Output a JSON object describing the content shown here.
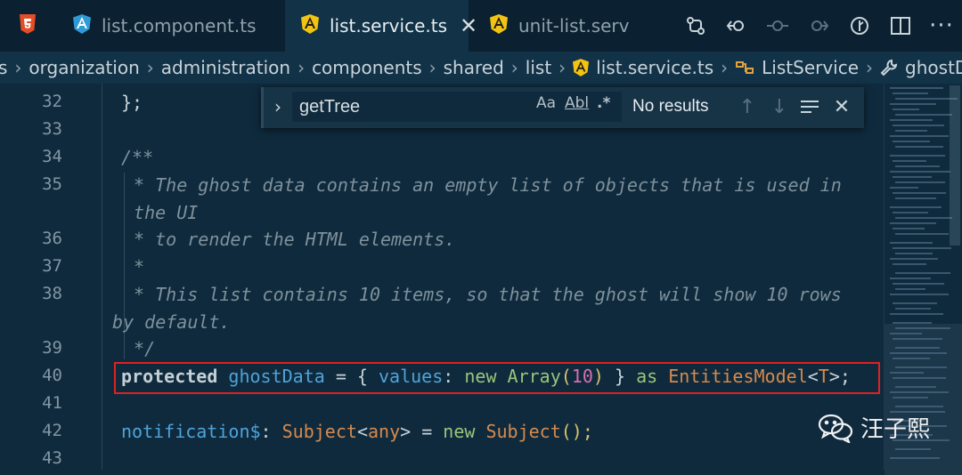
{
  "tabs": [
    {
      "label": "",
      "icon": "html5-icon",
      "active": false
    },
    {
      "label": "list.component.ts",
      "icon": "angular-icon",
      "active": false
    },
    {
      "label": "list.service.ts",
      "icon": "angular-icon",
      "active": true,
      "close": "✕"
    },
    {
      "label": "unit-list.servic",
      "icon": "angular-icon",
      "active": false
    }
  ],
  "breadcrumb": {
    "items": [
      "s",
      "organization",
      "administration",
      "components",
      "shared",
      "list",
      "list.service.ts",
      "ListService",
      "ghostData"
    ]
  },
  "find": {
    "value": "getTree",
    "match_case": "Aa",
    "whole_word": "Abl",
    "regex": ".*",
    "status": "No results"
  },
  "code": {
    "line_numbers": [
      "32",
      "33",
      "34",
      "35",
      "",
      "36",
      "37",
      "38",
      "",
      "39",
      "40",
      "41",
      "42",
      "43"
    ],
    "partial_top": "  ",
    "l32": "};",
    "l34": "/**",
    "l35a": " * The ghost data contains an empty list of objects that is used in",
    "l35b": " the UI",
    "l36": " * to render the HTML elements.",
    "l37": " *",
    "l38a": " * This list contains 10 items, so that the ghost will show 10 rows",
    "l38b": " by default.",
    "l39": " */",
    "l40": {
      "kw": "protected",
      "var": "ghostData",
      "eq": " = { ",
      "prop": "values",
      "colon": ": ",
      "new": "new ",
      "arr": "Array",
      "paren_open": "(",
      "num": "10",
      "paren_close": ")",
      "close": " } ",
      "as": "as ",
      "type": "EntitiesModel",
      "lt": "<",
      "tp": "T",
      "gt": ">;"
    },
    "l42": {
      "var": "notification$",
      "colon": ": ",
      "type": "Subject",
      "lt": "<",
      "any": "any",
      "gt": "> = ",
      "new": "new ",
      "cls": "Subject",
      "end": "();"
    }
  },
  "watermark": "汪子熙",
  "colors": {
    "accent_red": "#e02020",
    "background": "#0f2a3d"
  }
}
